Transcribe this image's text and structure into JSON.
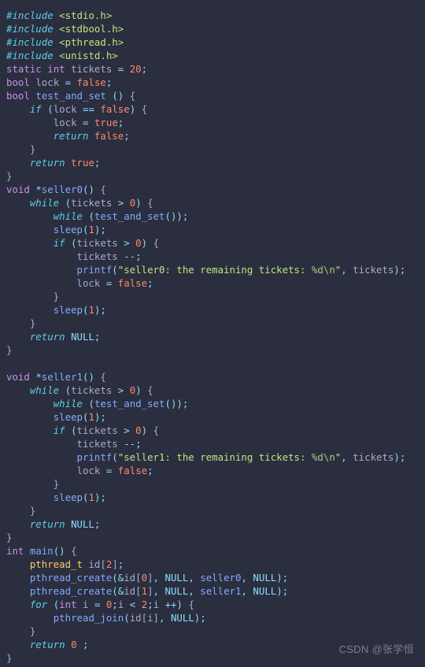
{
  "editor": {
    "background": "#2b2e3f",
    "language": "c",
    "font_size_px": 12.4,
    "line_height_px": 17
  },
  "colors": {
    "background": "#2b2e3f",
    "default_text": "#a6accd",
    "preprocessor": "#5ccfe6",
    "header_string": "#bae67e",
    "keyword": "#c792ea",
    "keyword_italic": "#5ccfe6",
    "type": "#ffcb6b",
    "function": "#82aaff",
    "constant": "#f78c6c",
    "null_literal": "#89ddff",
    "string": "#bae67e",
    "escape": "#a3cb7a",
    "punctuation": "#89ddff",
    "watermark": "#8a8fa3"
  },
  "code": {
    "lines": [
      "#include <stdio.h>",
      "#include <stdbool.h>",
      "#include <pthread.h>",
      "#include <unistd.h>",
      "static int tickets = 20;",
      "bool lock = false;",
      "bool test_and_set () {",
      "    if (lock == false) {",
      "        lock = true;",
      "        return false;",
      "    }",
      "    return true;",
      "}",
      "void *seller0() {",
      "    while (tickets > 0) {",
      "        while (test_and_set());",
      "        sleep(1);",
      "        if (tickets > 0) {",
      "            tickets --;",
      "            printf(\"seller0: the remaining tickets: %d\\n\", tickets);",
      "            lock = false;",
      "        }",
      "        sleep(1);",
      "    }",
      "    return NULL;",
      "}",
      "",
      "void *seller1() {",
      "    while (tickets > 0) {",
      "        while (test_and_set());",
      "        sleep(1);",
      "        if (tickets > 0) {",
      "            tickets --;",
      "            printf(\"seller1: the remaining tickets: %d\\n\", tickets);",
      "            lock = false;",
      "        }",
      "        sleep(1);",
      "    }",
      "    return NULL;",
      "}",
      "int main() {",
      "    pthread_t id[2];",
      "    pthread_create(&id[0], NULL, seller0, NULL);",
      "    pthread_create(&id[1], NULL, seller1, NULL);",
      "    for (int i = 0;i < 2;i ++) {",
      "        pthread_join(id[i], NULL);",
      "    }",
      "    return 0 ;",
      "}"
    ]
  },
  "watermark": {
    "text": "CSDN @张学恒"
  }
}
